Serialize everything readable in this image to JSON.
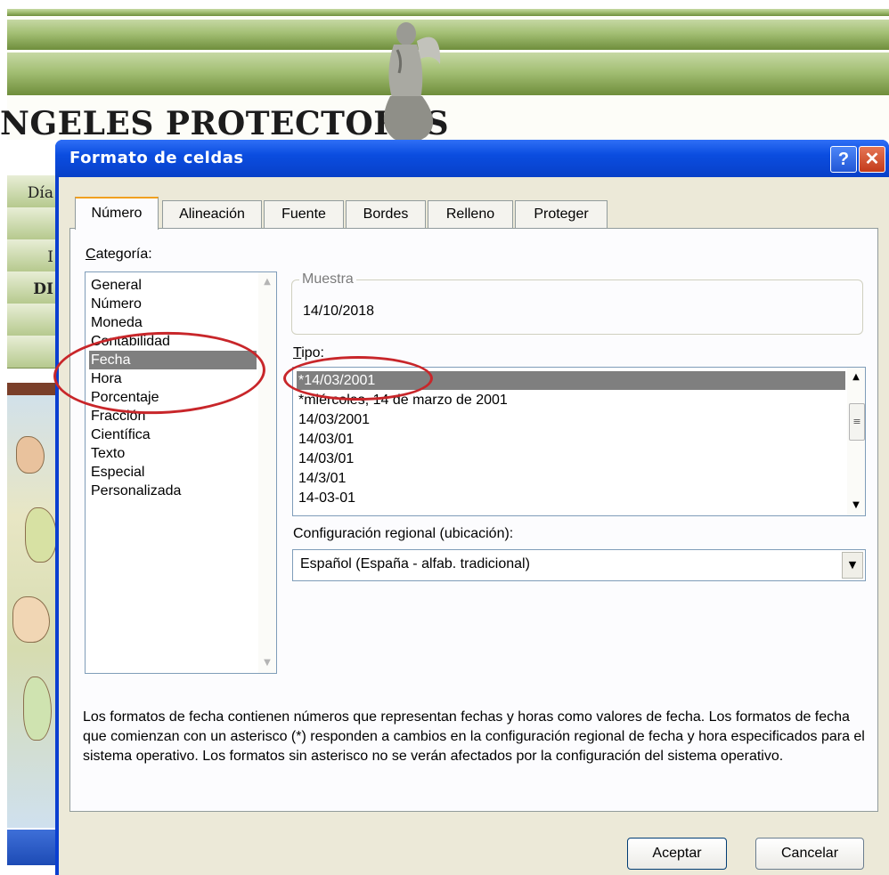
{
  "background": {
    "banner_title": "NGELES PROTECTORES",
    "left_rows": [
      "Día",
      "I",
      "DI"
    ]
  },
  "dialog": {
    "title": "Formato de celdas",
    "help_button": "?",
    "close_button": "✕",
    "tabs": [
      {
        "label": "Número",
        "active": true
      },
      {
        "label": "Alineación",
        "active": false
      },
      {
        "label": "Fuente",
        "active": false
      },
      {
        "label": "Bordes",
        "active": false
      },
      {
        "label": "Relleno",
        "active": false
      },
      {
        "label": "Proteger",
        "active": false
      }
    ],
    "category": {
      "label": "Categoría:",
      "items": [
        "General",
        "Número",
        "Moneda",
        "Contabilidad",
        "Fecha",
        "Hora",
        "Porcentaje",
        "Fracción",
        "Científica",
        "Texto",
        "Especial",
        "Personalizada"
      ],
      "selected": "Fecha"
    },
    "sample": {
      "label": "Muestra",
      "value": "14/10/2018"
    },
    "type": {
      "label": "Tipo:",
      "items": [
        "*14/03/2001",
        "*miércoles, 14 de marzo de 2001",
        "14/03/2001",
        "14/03/01",
        "14/03/01",
        "14/3/01",
        "14-03-01"
      ],
      "selected": "*14/03/2001"
    },
    "locale": {
      "label": "Configuración regional (ubicación):",
      "value": "Español (España - alfab. tradicional)"
    },
    "description": "Los formatos de fecha contienen números que representan fechas y horas como valores de fecha. Los formatos de fecha que comienzan con un asterisco (*) responden a cambios en la configuración regional de fecha y hora especificados para el sistema operativo. Los formatos sin asterisco no se verán afectados por la configuración del sistema operativo.",
    "buttons": {
      "ok": "Aceptar",
      "cancel": "Cancelar"
    }
  },
  "colors": {
    "titlebar": "#0b4de0",
    "dialog_face": "#ece9d8",
    "selection": "#7f7f7f",
    "annotation": "#c8262a"
  }
}
